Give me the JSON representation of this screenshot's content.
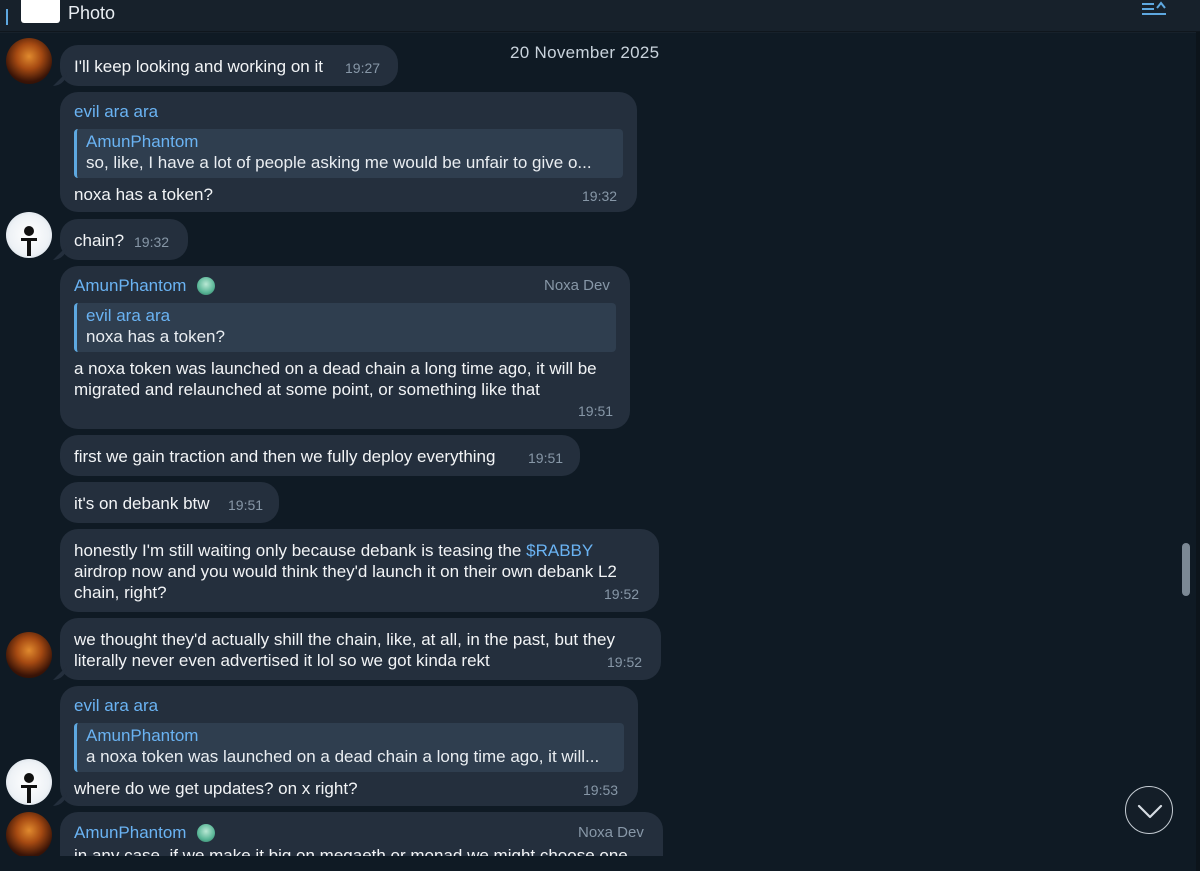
{
  "header": {
    "pinned_label": "Photo"
  },
  "date_chip": "20 November 2025",
  "messages": [
    {
      "text": "I'll keep looking and working on it",
      "time": "19:27"
    },
    {
      "sender": "evil ara ara",
      "quote_name": "AmunPhantom",
      "quote_text": "so, like, I have a lot of people asking me  would be unfair to give o...",
      "text": "noxa has a token?",
      "time": "19:32"
    },
    {
      "text": "chain?",
      "time": "19:32"
    },
    {
      "sender": "AmunPhantom",
      "role": "Noxa Dev",
      "quote_name": "evil ara ara",
      "quote_text": "noxa has a token?",
      "text_line1": "a noxa token was launched on a dead chain a long time ago, it will be",
      "text_line2": "migrated and relaunched at some point, or something like that",
      "time": "19:51"
    },
    {
      "text": "first we gain traction and then we fully deploy everything",
      "time": "19:51"
    },
    {
      "text": "it's on debank btw",
      "time": "19:51"
    },
    {
      "text_before_link": "honestly I'm still waiting only because debank is teasing the ",
      "link": "$RABBY",
      "text_line2": "airdrop now and you would think they'd launch it on their own debank L2",
      "text_line3": "chain, right?",
      "time": "19:52"
    },
    {
      "text_line1": "we thought they'd actually shill the chain, like, at all, in the past, but they",
      "text_line2": "literally never even advertised it lol so we got kinda rekt",
      "time": "19:52"
    },
    {
      "sender": "evil ara ara",
      "quote_name": "AmunPhantom",
      "quote_text": "a noxa token was launched on a dead chain a long time ago, it will...",
      "text": "where do we get updates? on x right?",
      "time": "19:53"
    },
    {
      "sender": "AmunPhantom",
      "role": "Noxa Dev",
      "text": "in any case, if we make it big on megaeth or monad we might choose one"
    }
  ]
}
